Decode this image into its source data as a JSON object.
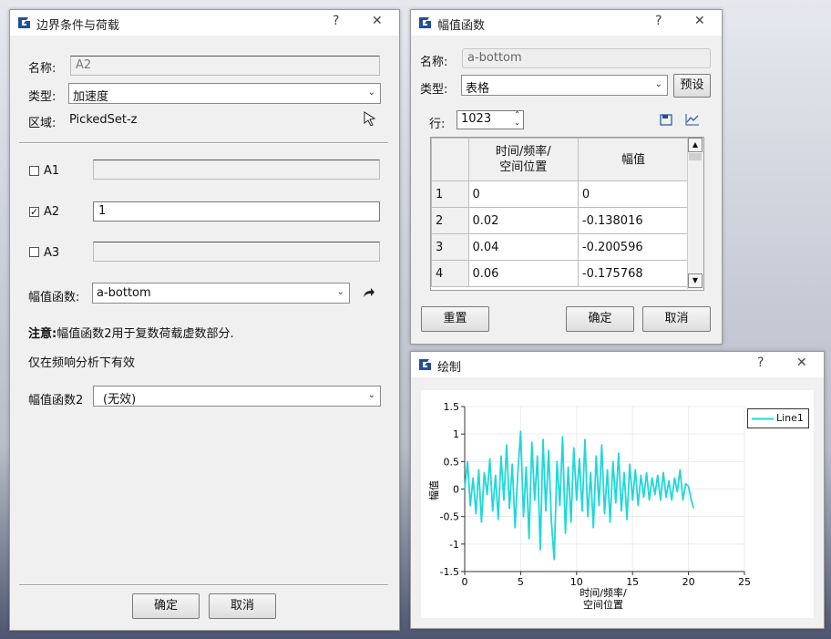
{
  "win1": {
    "title": "边界条件与荷载",
    "help": "?",
    "close": "✕",
    "name_label": "名称:",
    "name_value": "A2",
    "type_label": "类型:",
    "type_value": "加速度",
    "region_label": "区域:",
    "region_value": "PickedSet-z",
    "a1_label": "A1",
    "a1_value": "",
    "a2_label": "A2",
    "a2_value": "1",
    "a3_label": "A3",
    "a3_value": "",
    "amp_label": "幅值函数:",
    "amp_value": "a-bottom",
    "note_bold": "注意:",
    "note_text": "幅值函数2用于复数荷载虚数部分.",
    "note2": "仅在频响分析下有效",
    "amp2_label": "幅值函数2",
    "amp2_value": "(无效)",
    "ok": "确定",
    "cancel": "取消",
    "checks": {
      "a1": "",
      "a2": "✓",
      "a3": ""
    }
  },
  "win2": {
    "title": "幅值函数",
    "help": "?",
    "close": "✕",
    "name_label": "名称:",
    "name_value": "a-bottom",
    "type_label": "类型:",
    "type_value": "表格",
    "preset": "预设",
    "rows_label": "行:",
    "rows_value": "1023",
    "col1_line1": "时间/频率/",
    "col1_line2": "空间位置",
    "col2": "幅值",
    "rows": [
      {
        "n": "1",
        "t": "0",
        "v": "0"
      },
      {
        "n": "2",
        "t": "0.02",
        "v": "-0.138016"
      },
      {
        "n": "3",
        "t": "0.04",
        "v": "-0.200596"
      },
      {
        "n": "4",
        "t": "0.06",
        "v": "-0.175768"
      }
    ],
    "reset": "重置",
    "ok": "确定",
    "cancel": "取消"
  },
  "win3": {
    "title": "绘制",
    "help": "?",
    "close": "✕"
  },
  "chart_data": {
    "type": "line",
    "title": "",
    "xlabel_line1": "时间/频率/",
    "xlabel_line2": "空间位置",
    "ylabel": "幅值",
    "xlim": [
      0,
      25
    ],
    "ylim": [
      -1.5,
      1.5
    ],
    "xticks": [
      "0",
      "5",
      "10",
      "15",
      "20",
      "25"
    ],
    "yticks": [
      "1.5",
      "1",
      "0.5",
      "0",
      "-0.5",
      "-1",
      "-1.5"
    ],
    "grid": true,
    "legend": "top-right",
    "color": "#1fd8d8",
    "series": [
      {
        "name": "Line1",
        "x": [
          0,
          0.25,
          0.5,
          0.75,
          1,
          1.25,
          1.5,
          1.75,
          2,
          2.25,
          2.5,
          2.75,
          3,
          3.25,
          3.5,
          3.75,
          4,
          4.25,
          4.5,
          4.75,
          5,
          5.25,
          5.5,
          5.75,
          6,
          6.25,
          6.5,
          6.75,
          7,
          7.25,
          7.5,
          7.75,
          8,
          8.25,
          8.5,
          8.75,
          9,
          9.25,
          9.5,
          9.75,
          10,
          10.25,
          10.5,
          10.75,
          11,
          11.25,
          11.5,
          11.75,
          12,
          12.25,
          12.5,
          12.75,
          13,
          13.25,
          13.5,
          13.75,
          14,
          14.25,
          14.5,
          14.75,
          15,
          15.25,
          15.5,
          15.75,
          16,
          16.25,
          16.5,
          16.75,
          17,
          17.25,
          17.5,
          17.75,
          18,
          18.25,
          18.5,
          18.75,
          19,
          19.25,
          19.5,
          19.75,
          20,
          20.25,
          20.46
        ],
        "y": [
          0,
          0.5,
          -0.3,
          0.2,
          -0.45,
          0.35,
          -0.6,
          0.3,
          -0.1,
          0.55,
          -0.4,
          0.25,
          -0.55,
          0.6,
          -0.2,
          0.8,
          -0.35,
          0.45,
          -0.7,
          0.3,
          1.05,
          -0.5,
          0.4,
          -0.9,
          0.85,
          -0.2,
          0.6,
          -1.1,
          0.9,
          -0.4,
          0.7,
          -0.6,
          -1.28,
          0.5,
          -0.3,
          0.95,
          -0.8,
          0.4,
          -0.6,
          0.75,
          -0.2,
          0.55,
          -0.4,
          0.9,
          -0.5,
          0.3,
          -0.7,
          0.6,
          -0.3,
          0.8,
          -0.45,
          0.35,
          -0.6,
          0.5,
          -0.25,
          0.65,
          -0.4,
          0.3,
          -0.55,
          0.45,
          -0.2,
          0.35,
          -0.3,
          0.25,
          -0.15,
          0.3,
          -0.2,
          0.2,
          -0.1,
          0.25,
          -0.2,
          0.3,
          -0.15,
          0.15,
          -0.2,
          0.2,
          -0.05,
          0.35,
          -0.2,
          0.1,
          0.05,
          -0.2,
          -0.35
        ]
      }
    ]
  }
}
